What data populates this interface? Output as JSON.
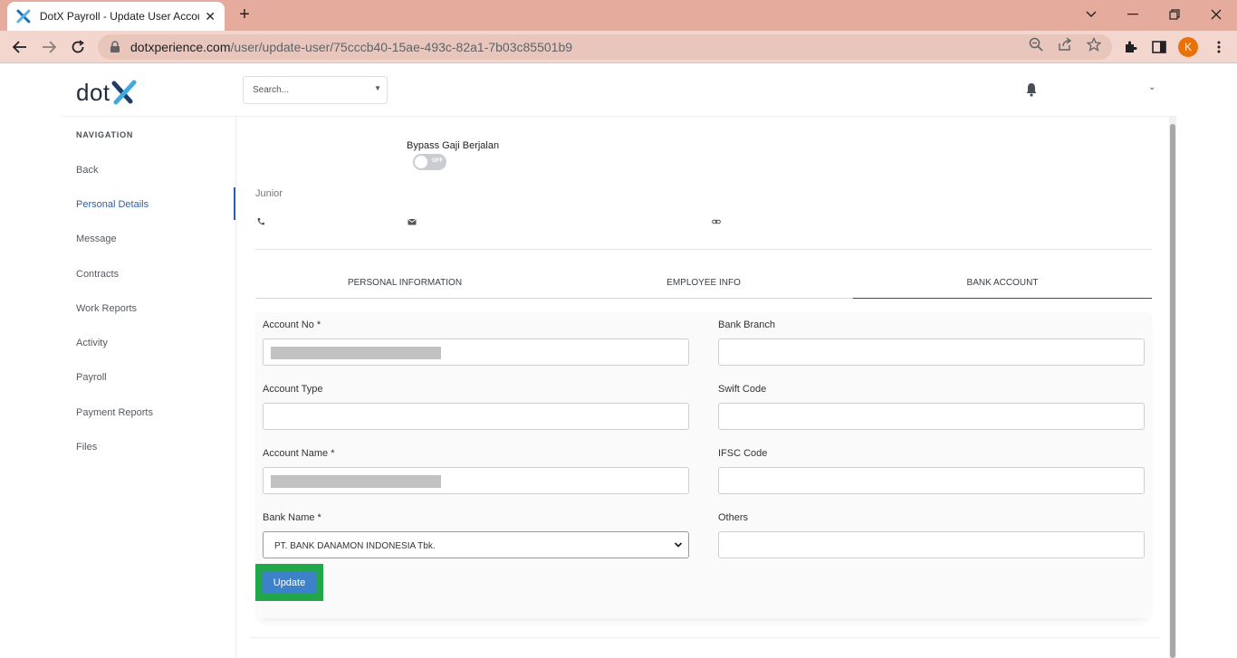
{
  "browser": {
    "tab_title": "DotX Payroll - Update User Accou",
    "url_host": "dotxperience.com",
    "url_path": "/user/update-user/75cccb40-15ae-493c-82a1-7b03c85501b9",
    "profile_initial": "K"
  },
  "header": {
    "logo_text": "dot",
    "search_placeholder": "Search..."
  },
  "sidebar": {
    "title": "NAVIGATION",
    "items": [
      {
        "label": "Back"
      },
      {
        "label": "Personal Details",
        "active": true
      },
      {
        "label": "Message"
      },
      {
        "label": "Contracts"
      },
      {
        "label": "Work Reports"
      },
      {
        "label": "Activity"
      },
      {
        "label": "Payroll"
      },
      {
        "label": "Payment Reports"
      },
      {
        "label": "Files"
      }
    ]
  },
  "profile": {
    "bypass_label": "Bypass Gaji Berjalan",
    "toggle_state": "OFF",
    "role": "Junior"
  },
  "tabs": [
    {
      "label": "PERSONAL INFORMATION"
    },
    {
      "label": "EMPLOYEE INFO"
    },
    {
      "label": "BANK ACCOUNT",
      "active": true
    }
  ],
  "form": {
    "account_no_label": "Account No *",
    "account_type_label": "Account Type",
    "account_name_label": "Account Name *",
    "bank_name_label": "Bank Name *",
    "bank_name_value": "PT. BANK DANAMON INDONESIA Tbk.",
    "bank_branch_label": "Bank Branch",
    "swift_code_label": "Swift Code",
    "ifsc_code_label": "IFSC Code",
    "others_label": "Others",
    "update_label": "Update"
  },
  "colors": {
    "accent": "#2e5fa8",
    "update_button": "#3d82c9",
    "highlight": "#21a64a",
    "browser_frame": "#e5ab9c"
  }
}
